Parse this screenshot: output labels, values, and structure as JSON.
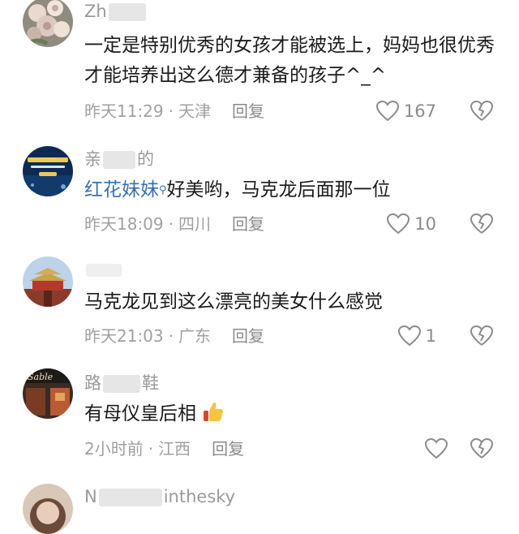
{
  "comments": [
    {
      "username_visible": "Zh",
      "text": "一定是特别优秀的女孩才能被选上，妈妈也很优秀才能培养出这么德才兼备的孩子^_^",
      "time": "昨天11:29",
      "location": "天津",
      "reply_label": "回复",
      "likes": "167"
    },
    {
      "username_visible_a": "亲",
      "username_visible_b": "的",
      "reply_to": "红花妹妹",
      "text": "好美哟，马克龙后面那一位",
      "time": "昨天18:09",
      "location": "四川",
      "reply_label": "回复",
      "likes": "10"
    },
    {
      "text": "马克龙见到这么漂亮的美女什么感觉",
      "time": "昨天21:03",
      "location": "广东",
      "reply_label": "回复",
      "likes": "1"
    },
    {
      "username_visible_a": "路",
      "username_visible_b": "鞋",
      "text": "有母仪皇后相",
      "time": "2小时前",
      "location": "江西",
      "reply_label": "回复",
      "likes": ""
    },
    {
      "username_visible_a": "N",
      "username_visible_b": "inthesky"
    }
  ],
  "avatar4_sign": "Sable"
}
